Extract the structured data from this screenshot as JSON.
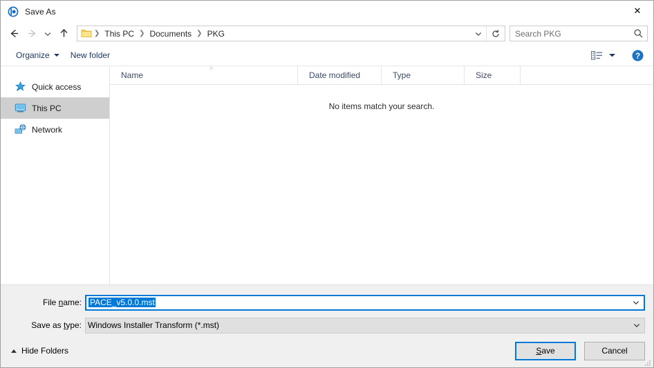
{
  "window": {
    "title": "Save As",
    "app_icon": "app-icon",
    "close_label": "✕"
  },
  "nav": {
    "back_icon": "back-arrow-icon",
    "forward_icon": "forward-arrow-icon",
    "recent_icon": "recent-locations-chevron-icon",
    "up_icon": "up-arrow-icon",
    "breadcrumbs": [
      {
        "label": "This PC"
      },
      {
        "label": "Documents"
      },
      {
        "label": "PKG"
      }
    ],
    "separator": "❯",
    "address_dropdown_icon": "chevron-down-icon",
    "refresh_icon": "refresh-icon"
  },
  "search": {
    "placeholder": "Search PKG",
    "value": "",
    "icon": "search-icon"
  },
  "toolbar": {
    "organize_label": "Organize",
    "new_folder_label": "New folder",
    "view_icon": "view-layout-icon",
    "view_dropdown_icon": "chevron-down-icon",
    "help_icon": "help-icon",
    "help_label": "?"
  },
  "sidebar": {
    "items": [
      {
        "label": "Quick access",
        "icon": "star-pin-icon",
        "selected": false
      },
      {
        "label": "This PC",
        "icon": "monitor-icon",
        "selected": true
      },
      {
        "label": "Network",
        "icon": "network-icon",
        "selected": false
      }
    ]
  },
  "filelist": {
    "columns": [
      {
        "label": "Name"
      },
      {
        "label": "Date modified"
      },
      {
        "label": "Type"
      },
      {
        "label": "Size"
      }
    ],
    "sort_indicator": "˄",
    "empty_message": "No items match your search.",
    "rows": []
  },
  "form": {
    "filename": {
      "label_pre": "File ",
      "label_key": "n",
      "label_post": "ame:",
      "value": "PACE_v5.0.0.mst",
      "selected": true,
      "dropdown_icon": "chevron-down-icon"
    },
    "savetype": {
      "label_pre": "Save as ",
      "label_key": "t",
      "label_post": "ype:",
      "value": "Windows Installer Transform  (*.mst)",
      "dropdown_icon": "chevron-down-icon"
    }
  },
  "footer": {
    "hide_folders_label": "Hide Folders",
    "hide_folders_icon": "chevron-up-icon",
    "save": {
      "pre": "",
      "key": "S",
      "post": "ave"
    },
    "cancel": {
      "label": "Cancel"
    },
    "resize_grip_icon": "resize-grip-icon"
  },
  "colors": {
    "accent": "#0078d7",
    "selection": "#0078d7",
    "sidebar_selected": "#cfcfcf",
    "footer_bg": "#f0f0f0",
    "folder_yellow": "#ffd95a"
  }
}
